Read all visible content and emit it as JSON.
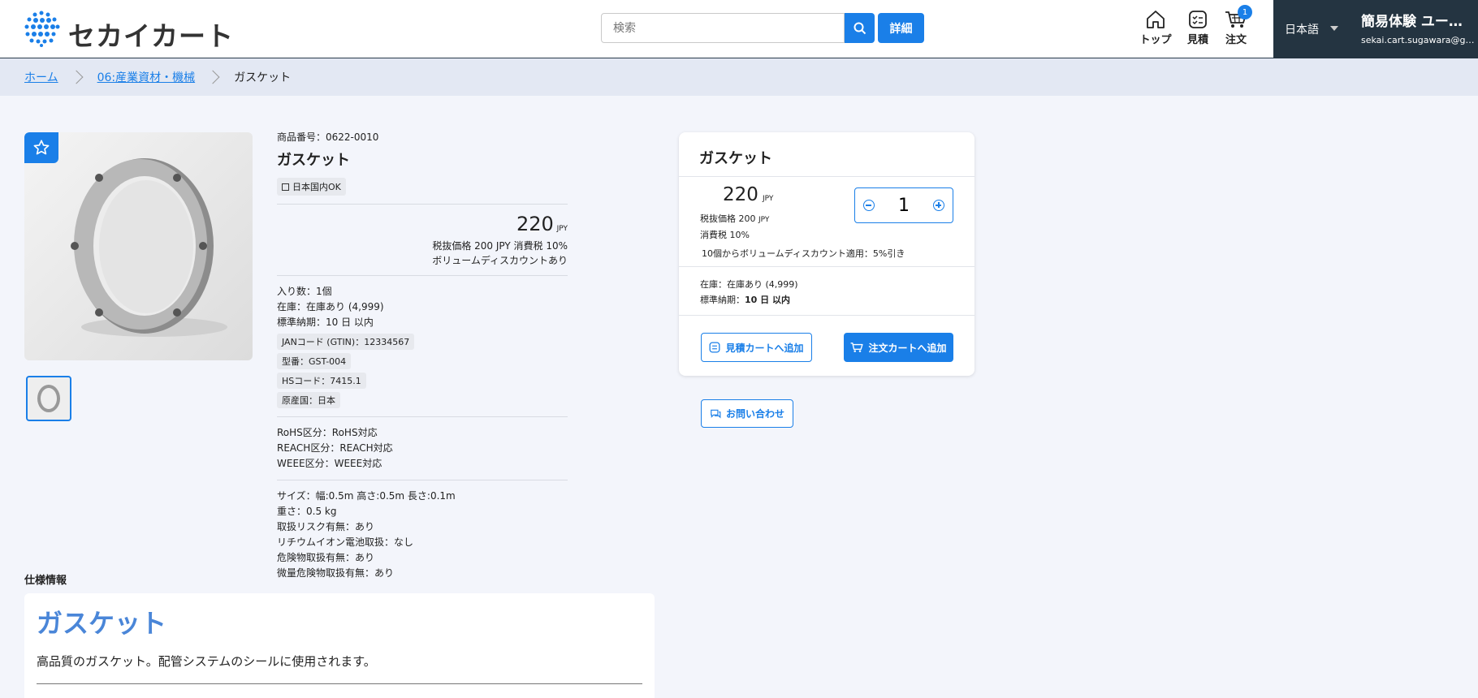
{
  "header": {
    "logo_text": "セカイカート",
    "search_placeholder": "検索",
    "detail_button": "詳細",
    "nav": {
      "top": "トップ",
      "quote": "見積",
      "order": "注文",
      "cart_count": "1"
    },
    "language": "日本語",
    "user_name": "簡易体験 ユー…",
    "user_email": "sekai.cart.sugawara@g…"
  },
  "breadcrumb": [
    "ホーム",
    "06:産業資材・機械",
    "ガスケット"
  ],
  "product": {
    "number": "商品番号：0622-0010",
    "title": "ガスケット",
    "domestic_tag": "日本国内OK",
    "price": "220",
    "currency": "JPY",
    "tax_line": "税抜価格 200 JPY 消費税 10%",
    "volume_discount": "ボリュームディスカウントあり",
    "quantity_per": "入り数：1個",
    "stock": "在庫：在庫あり (4,999)",
    "lead_time": "標準納期：10 日 以内",
    "chips": [
      "JANコード (GTIN)：12334567",
      "型番：GST-004",
      "HSコード：7415.1",
      "原産国：日本"
    ],
    "compliance": [
      "RoHS区分：RoHS対応",
      "REACH区分：REACH対応",
      "WEEE区分：WEEE対応"
    ],
    "attributes": [
      "サイズ：幅:0.5m 高さ:0.5m 長さ:0.1m",
      "重さ：0.5 kg",
      "取扱リスク有無：あり",
      "リチウムイオン電池取扱：なし",
      "危険物取扱有無：あり",
      "微量危険物取扱有無：あり"
    ]
  },
  "card": {
    "title": "ガスケット",
    "price": "220",
    "currency": "JPY",
    "tax_excl": "税抜価格 200",
    "tax_rate": "消費税 10%",
    "discount_note": "10個からボリュームディスカウント適用：5%引き",
    "quantity": "1",
    "stock": "在庫：在庫あり (4,999)",
    "lead_label": "標準納期：",
    "lead_value": "10 日 以内",
    "add_quote": "見積カートへ追加",
    "add_order": "注文カートへ追加"
  },
  "inquiry_button": "お問い合わせ",
  "spec": {
    "heading": "仕様情報",
    "title": "ガスケット",
    "description": "高品質のガスケット。配管システムのシールに使用されます。"
  },
  "colors": {
    "accent": "#1a7fe8",
    "dark": "#243441",
    "spec_title": "#4a86d8"
  }
}
